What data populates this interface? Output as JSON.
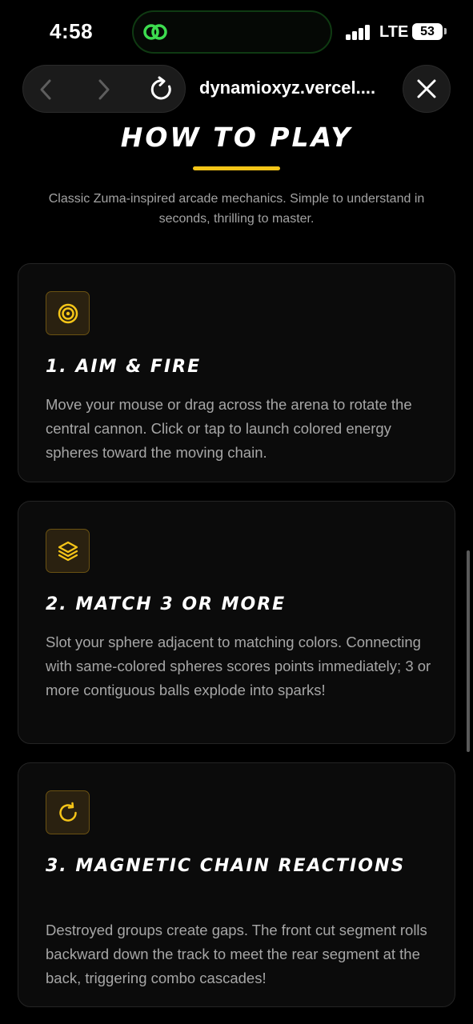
{
  "status_bar": {
    "time": "4:58",
    "network": "LTE",
    "battery": "53"
  },
  "browser": {
    "url": "dynamioxyz.vercel....",
    "back_icon": "chevron-left-icon",
    "forward_icon": "chevron-right-icon",
    "reload_icon": "reload-icon",
    "close_icon": "close-icon"
  },
  "section": {
    "title": "HOW TO PLAY",
    "subtitle": "Classic Zuma-inspired arcade mechanics. Simple to understand in seconds, thrilling to master."
  },
  "steps": [
    {
      "icon": "target-icon",
      "title": "1. AIM & FIRE",
      "text": "Move your mouse or drag across the arena to rotate the central cannon. Click or tap to launch colored energy spheres toward the moving chain."
    },
    {
      "icon": "layers-icon",
      "title": "2. MATCH 3 OR MORE",
      "text": "Slot your sphere adjacent to matching colors. Connecting with same-colored spheres scores points immediately; 3 or more contiguous balls explode into sparks!"
    },
    {
      "icon": "rotate-icon",
      "title": "3. MAGNETIC CHAIN REACTIONS",
      "text": "Destroyed groups create gaps. The front cut segment rolls backward down the track to meet the rear segment at the back, triggering combo cascades!"
    }
  ],
  "colors": {
    "accent": "#f5c518",
    "background": "#000000",
    "card": "#0b0b0b"
  }
}
